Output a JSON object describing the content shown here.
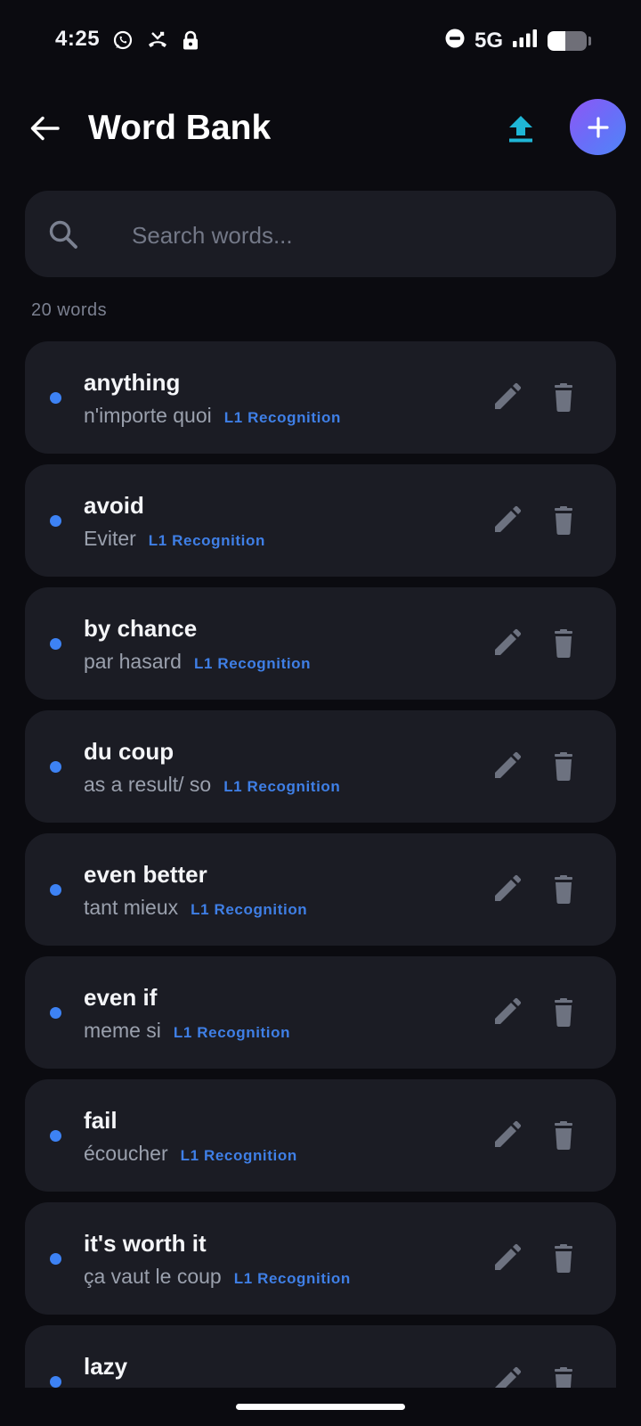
{
  "status_bar": {
    "time": "4:25",
    "network": "5G",
    "battery_level": 0.45,
    "left_icons": [
      "whatsapp-icon",
      "missed-call-icon",
      "lock-icon"
    ],
    "right_icons": [
      "do-not-disturb-icon",
      "signal-icon",
      "battery-icon"
    ]
  },
  "header": {
    "title": "Word Bank",
    "back_icon": "arrow-left-icon",
    "upload_icon": "upload-icon",
    "add_icon": "plus-icon"
  },
  "search": {
    "placeholder": "Search words...",
    "value": ""
  },
  "word_count": "20 words",
  "colors": {
    "background": "#0b0b10",
    "card": "#1b1c24",
    "accent_blue": "#3d82f4",
    "upload_cyan": "#1fb6d6",
    "add_gradient_start": "#8e57f5",
    "add_gradient_end": "#4f86f7"
  },
  "words": [
    {
      "term": "anything",
      "translation": "n'importe quoi",
      "level": "L1 Recognition"
    },
    {
      "term": "avoid",
      "translation": "Eviter",
      "level": "L1 Recognition"
    },
    {
      "term": "by chance",
      "translation": "par hasard",
      "level": "L1 Recognition"
    },
    {
      "term": "du coup",
      "translation": "as a result/ so",
      "level": "L1 Recognition"
    },
    {
      "term": "even better",
      "translation": "tant mieux",
      "level": "L1 Recognition"
    },
    {
      "term": "even if",
      "translation": "meme si",
      "level": "L1 Recognition"
    },
    {
      "term": "fail",
      "translation": "écoucher",
      "level": "L1 Recognition"
    },
    {
      "term": "it's worth it",
      "translation": "ça vaut le coup",
      "level": "L1 Recognition"
    },
    {
      "term": "lazy",
      "translation": "",
      "level": ""
    }
  ]
}
